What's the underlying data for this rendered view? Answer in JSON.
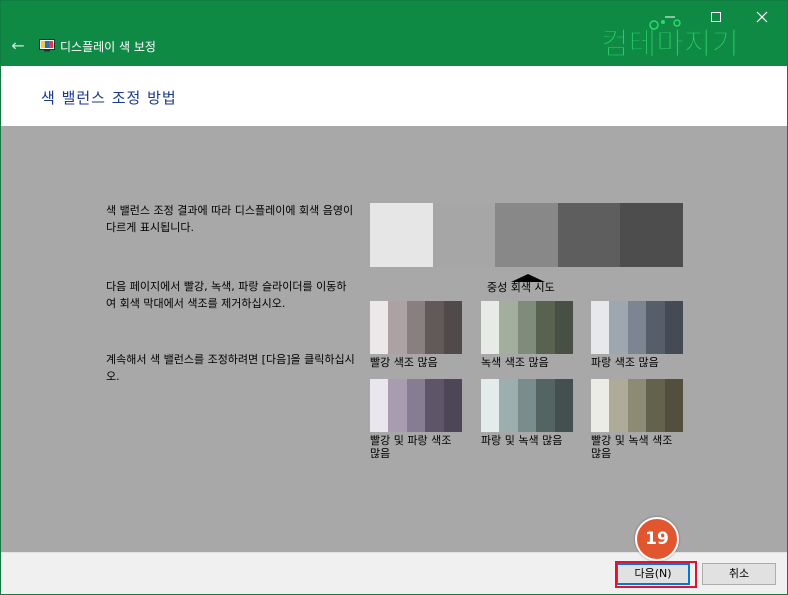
{
  "window": {
    "title": "디스플레이 색 보정"
  },
  "icons": {
    "back": "back-arrow-icon",
    "app": "display-monitor-icon",
    "minimize": "minimize-icon",
    "maximize": "maximize-icon",
    "close": "close-icon"
  },
  "watermark": {
    "text": "컴테마지기"
  },
  "heading": "색 밸런스 조정 방법",
  "paragraphs": {
    "p1": "색 밸런스 조정 결과에 따라 디스플레이에 회색 음영이 다르게 표시됩니다.",
    "p2": "다음 페이지에서 빨강, 녹색, 파랑 슬라이더를 이동하여 회색 막대에서 색조를 제거하십시오.",
    "p3": "계속해서 색 밸런스를 조정하려면 [다음]을 클릭하십시오."
  },
  "neutral_label": "중성 회색 시도",
  "balance_colors": [
    "#e6e6e6",
    "#a6a6a6",
    "#888888",
    "#5e5e5e",
    "#4d4d4d"
  ],
  "samples": [
    {
      "caption": "빨강 색조 많음",
      "colors": [
        "#ece8e9",
        "#aca2a3",
        "#8a7f80",
        "#625959",
        "#514a4a"
      ]
    },
    {
      "caption": "녹색 색조 많음",
      "colors": [
        "#e7ebe6",
        "#a3ae9f",
        "#7f8c7b",
        "#58624f",
        "#484f45"
      ]
    },
    {
      "caption": "파랑 색조 많음",
      "colors": [
        "#e6e8ec",
        "#9ea6b0",
        "#7d8592",
        "#565e6a",
        "#454b54"
      ]
    },
    {
      "caption": "빨강 및 파랑 색조 많음",
      "colors": [
        "#eae6ee",
        "#a89cb0",
        "#877d92",
        "#5e5569",
        "#4d4657"
      ]
    },
    {
      "caption": "파랑 및 녹색 많음",
      "colors": [
        "#e4ebeb",
        "#9cafae",
        "#7a8d8c",
        "#536463",
        "#444f50"
      ]
    },
    {
      "caption": "빨강 및 녹색 색조 많음",
      "colors": [
        "#ececE6",
        "#aeac98",
        "#8c8b74",
        "#63624d",
        "#524f3f"
      ]
    }
  ],
  "buttons": {
    "next": "다음(N)",
    "cancel": "취소"
  },
  "step_badge": "19",
  "colors": {
    "titlebar": "#0f8a45",
    "content": "#a8a8a8",
    "heading": "#1a3a8f",
    "highlight": "#e8112d",
    "badge": "#e2562f"
  }
}
